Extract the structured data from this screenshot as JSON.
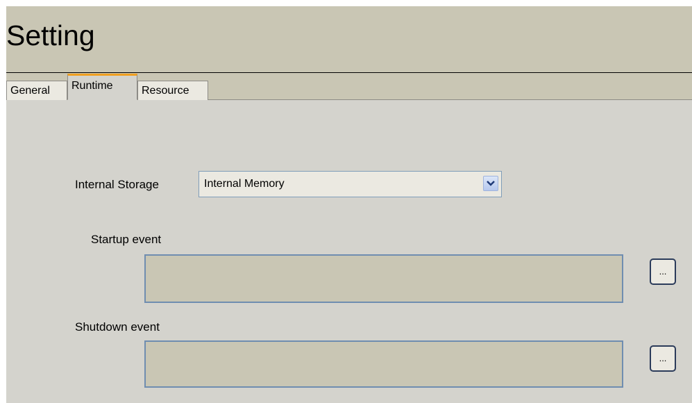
{
  "header": {
    "title": "Setting"
  },
  "tabs": [
    {
      "label": "General",
      "active": false
    },
    {
      "label": "Runtime",
      "active": true
    },
    {
      "label": "Resource",
      "active": false
    }
  ],
  "runtime": {
    "internal_storage": {
      "label": "Internal Storage",
      "value": "Internal Memory"
    },
    "startup_event": {
      "label": "Startup event",
      "value": "",
      "browse_label": "..."
    },
    "shutdown_event": {
      "label": "Shutdown event",
      "value": "",
      "browse_label": "..."
    }
  },
  "colors": {
    "header_bg": "#c9c6b4",
    "panel_bg": "#d4d3cd",
    "active_tab_accent": "#f0a020",
    "field_border": "#6f8db0"
  },
  "icons": {
    "dropdown": "chevron-down-icon"
  }
}
